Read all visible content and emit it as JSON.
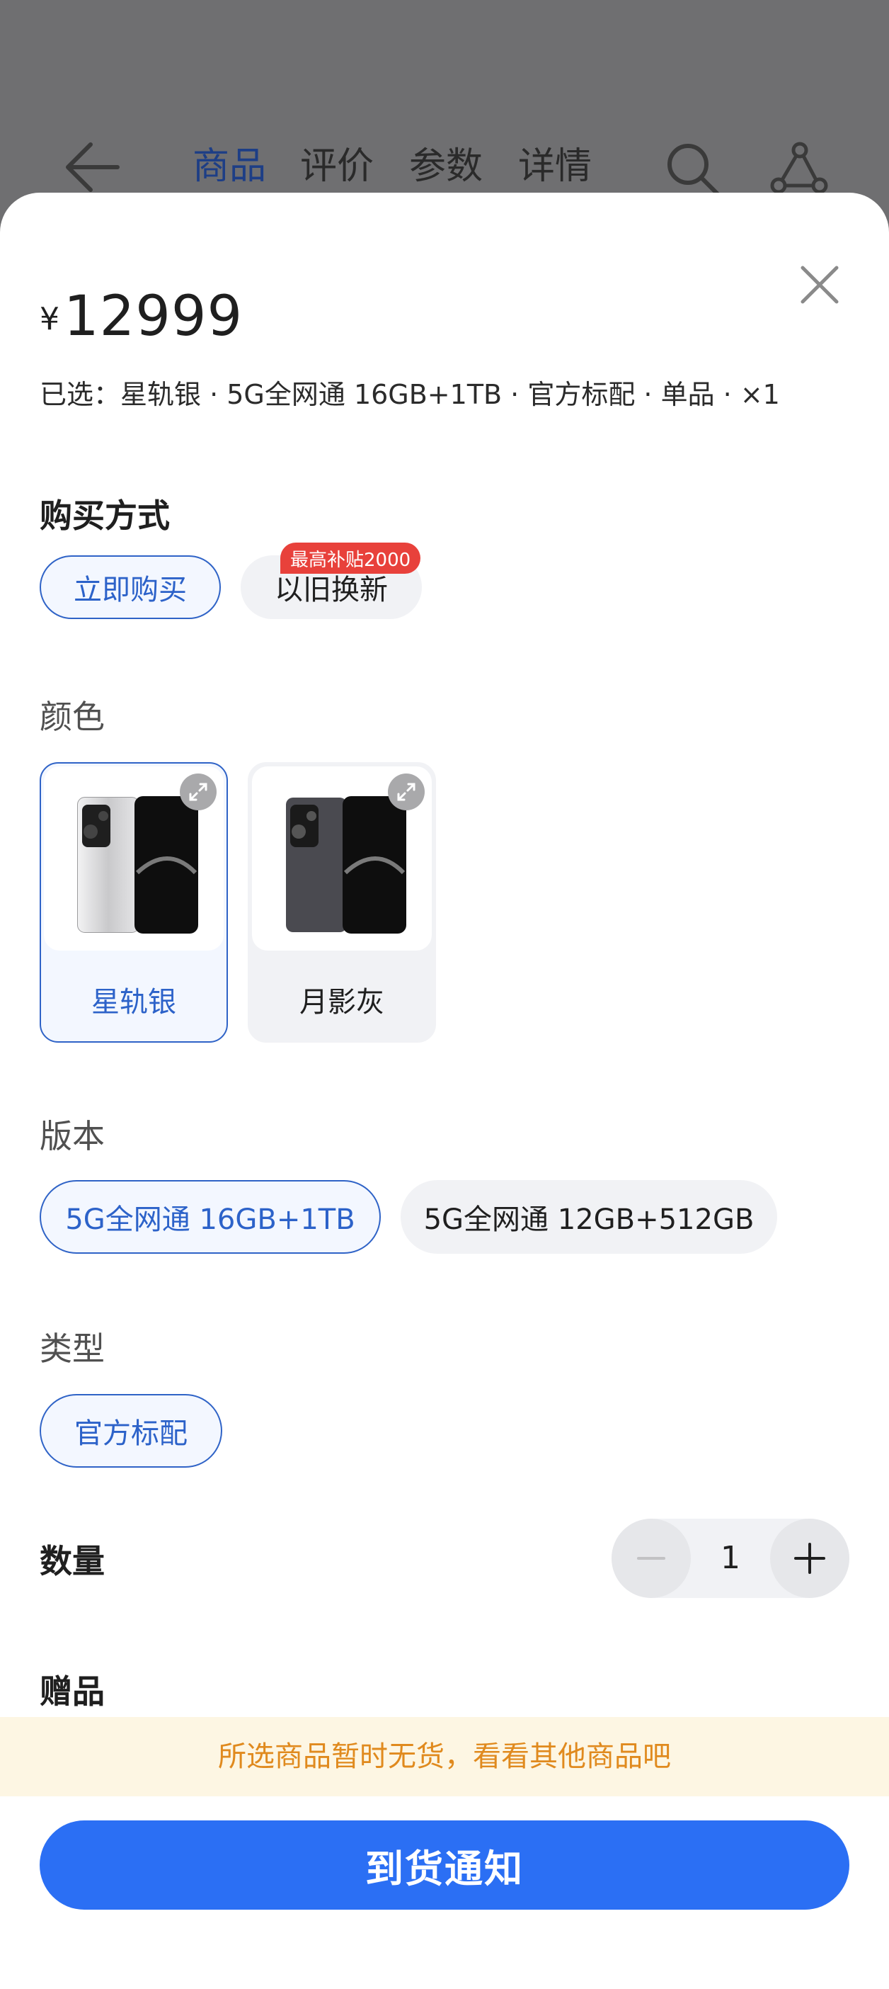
{
  "background_header": {
    "tabs": [
      "商品",
      "评价",
      "参数",
      "详情"
    ],
    "active_tab": 0
  },
  "price": {
    "currency": "¥",
    "amount": "12999"
  },
  "selected_summary": "已选：星轨银 · 5G全网通 16GB+1TB · 官方标配 · 单品 · ×1",
  "purchase_method": {
    "title": "购买方式",
    "options": [
      "立即购买",
      "以旧换新"
    ],
    "badge": "最高补贴2000",
    "selected": 0
  },
  "color": {
    "title": "颜色",
    "options": [
      "星轨银",
      "月影灰"
    ],
    "selected": 0
  },
  "version": {
    "title": "版本",
    "options": [
      "5G全网通 16GB+1TB",
      "5G全网通 12GB+512GB"
    ],
    "selected": 0
  },
  "type": {
    "title": "类型",
    "options": [
      "官方标配"
    ],
    "selected": 0
  },
  "quantity": {
    "title": "数量",
    "value": "1"
  },
  "next_section_title": "赠品",
  "stock_notice": "所选商品暂时无货，看看其他商品吧",
  "primary_action": "到货通知",
  "colors": {
    "accent": "#2b6ff4",
    "selected_text": "#2c62c9",
    "badge": "#e8413b",
    "notice_bg": "#fdf6e3",
    "notice_text": "#e08a1e"
  }
}
